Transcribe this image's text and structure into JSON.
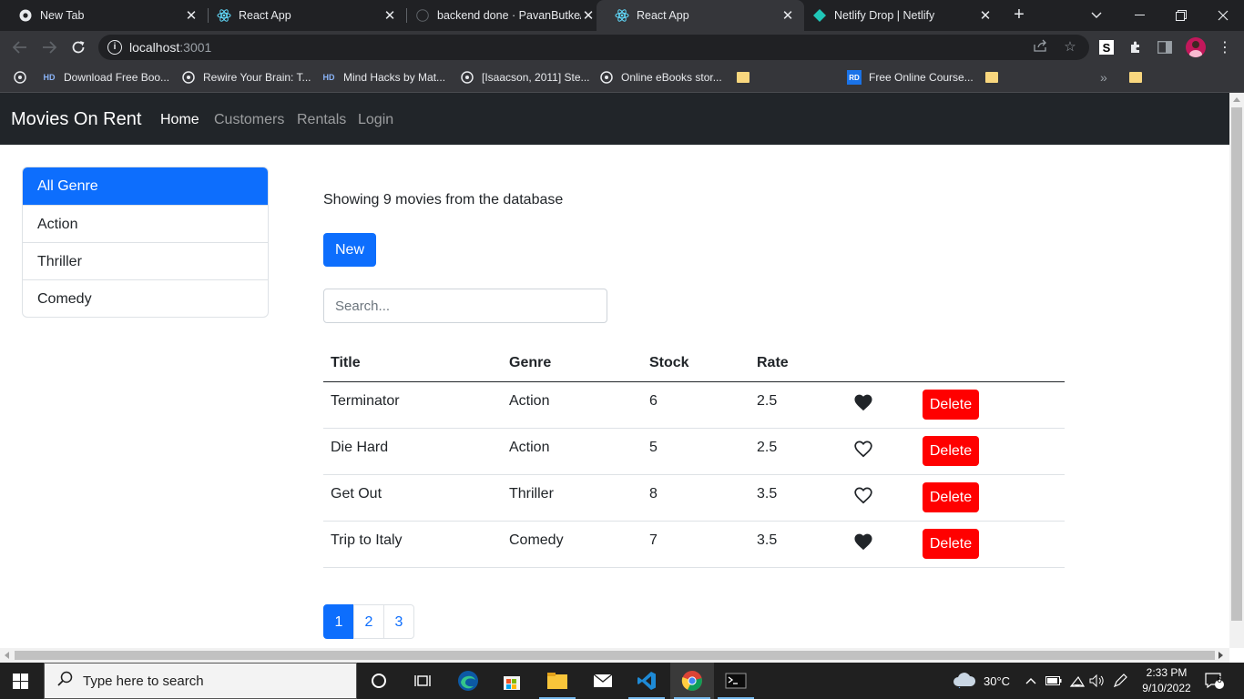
{
  "browser": {
    "tabs": [
      {
        "title": "New Tab",
        "icon": "chrome-icon",
        "active": false
      },
      {
        "title": "React App",
        "icon": "react-icon",
        "active": false
      },
      {
        "title": "backend done · PavanButke/",
        "icon": "github-icon",
        "active": false
      },
      {
        "title": "React App",
        "icon": "react-icon",
        "active": true
      },
      {
        "title": "Netlify Drop | Netlify",
        "icon": "netlify-icon",
        "active": false
      }
    ],
    "url_host": "localhost",
    "url_port": ":3001",
    "bookmarks": [
      {
        "label": "Download Free Boo...",
        "icon": "hd-icon"
      },
      {
        "label": "Rewire Your Brain: T...",
        "icon": "globe-icon"
      },
      {
        "label": "Mind Hacks by Mat...",
        "icon": "hd-icon"
      },
      {
        "label": "[Isaacson, 2011] Ste...",
        "icon": "globe-icon"
      },
      {
        "label": "Online eBooks stor...",
        "icon": "globe-icon"
      },
      {
        "label": "",
        "icon": "folder-icon"
      },
      {
        "label": "Free Online Course...",
        "icon": "rd-icon"
      },
      {
        "label": "",
        "icon": "folder-icon"
      },
      {
        "label": "",
        "icon": "folder-icon"
      }
    ],
    "overflow_chevron": "»",
    "profile_initial": "S"
  },
  "app": {
    "brand": "Movies On Rent",
    "nav": [
      "Home",
      "Customers",
      "Rentals",
      "Login"
    ],
    "active_nav": "Home",
    "genres": [
      "All Genre",
      "Action",
      "Thriller",
      "Comedy"
    ],
    "active_genre": "All Genre",
    "count_text": "Showing 9 movies from the database",
    "new_button": "New",
    "search_placeholder": "Search...",
    "table": {
      "headers": [
        "Title",
        "Genre",
        "Stock",
        "Rate"
      ],
      "delete_label": "Delete",
      "rows": [
        {
          "title": "Terminator",
          "genre": "Action",
          "stock": "6",
          "rate": "2.5",
          "liked": true
        },
        {
          "title": "Die Hard",
          "genre": "Action",
          "stock": "5",
          "rate": "2.5",
          "liked": false
        },
        {
          "title": "Get Out",
          "genre": "Thriller",
          "stock": "8",
          "rate": "3.5",
          "liked": false
        },
        {
          "title": "Trip to Italy",
          "genre": "Comedy",
          "stock": "7",
          "rate": "3.5",
          "liked": true
        }
      ]
    },
    "pages": [
      "1",
      "2",
      "3"
    ],
    "active_page": "1"
  },
  "taskbar": {
    "search_placeholder": "Type here to search",
    "temperature": "30°C",
    "time": "2:33 PM",
    "date": "9/10/2022",
    "notifications": "6",
    "colors": {
      "accent": "#0d6efd",
      "danger": "#ff0000",
      "navbar": "#212529"
    }
  }
}
